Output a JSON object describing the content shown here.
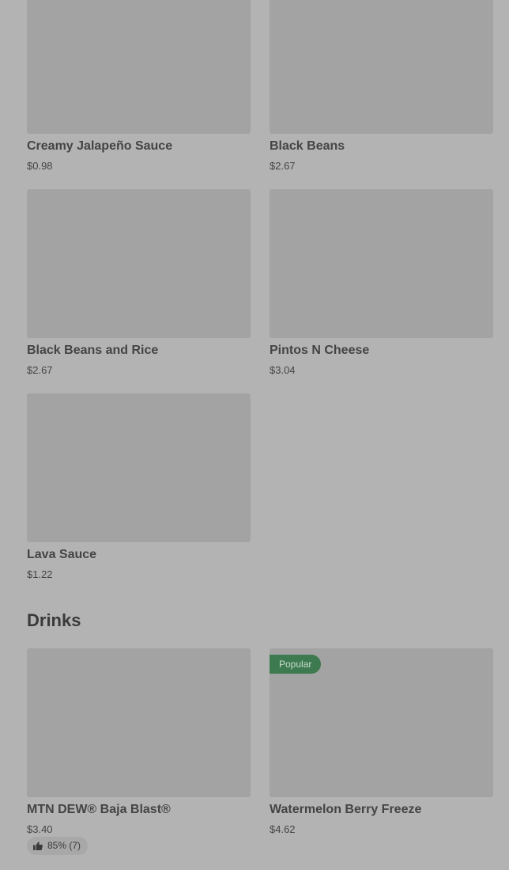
{
  "sauces": [
    {
      "name": "Creamy Jalapeño Sauce",
      "price": "$0.98"
    },
    {
      "name": "Black Beans",
      "price": "$2.67"
    },
    {
      "name": "Black Beans and Rice",
      "price": "$2.67"
    },
    {
      "name": "Pintos N Cheese",
      "price": "$3.04"
    },
    {
      "name": "Lava Sauce",
      "price": "$1.22"
    }
  ],
  "drinks_section": {
    "title": "Drinks",
    "items": [
      {
        "name": "MTN DEW® Baja Blast®",
        "price": "$3.40",
        "rating": "85% (7)"
      },
      {
        "name": "Watermelon Berry Freeze",
        "price": "$4.62",
        "badge": "Popular"
      }
    ]
  },
  "colors": {
    "overlay_background": "#b3b3b3",
    "image_placeholder": "#a3a3a3",
    "popular_badge": "#3e7a4f"
  },
  "icons": {
    "rating": "thumbs-up-icon"
  }
}
